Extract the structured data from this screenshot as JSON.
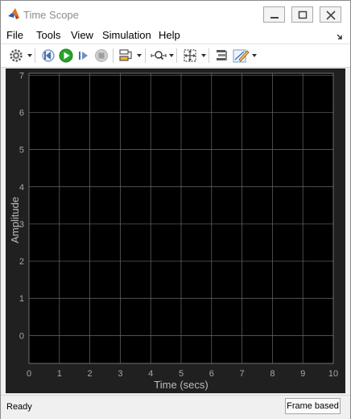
{
  "window": {
    "title": "Time Scope"
  },
  "menu": [
    {
      "label": "File"
    },
    {
      "label": "Tools"
    },
    {
      "label": "View"
    },
    {
      "label": "Simulation"
    },
    {
      "label": "Help"
    }
  ],
  "toolbar": {
    "icons": [
      "settings-icon",
      "step-back-icon",
      "run-icon",
      "step-forward-icon",
      "stop-icon",
      "highlight-icon",
      "zoom-icon",
      "fit-icon",
      "align-icon",
      "style-icon"
    ]
  },
  "colors": {
    "plot_background": "#000000",
    "axes_background": "#202020",
    "grid": "#6b6b6b",
    "tick_text": "#a8a8a8",
    "run_green": "#27a629"
  },
  "chart_data": {
    "type": "line",
    "xlabel": "Time (secs)",
    "ylabel": "Amplitude",
    "xlim": [
      0,
      10
    ],
    "ylim": [
      -0.75,
      7.05
    ],
    "xticks": [
      0,
      1,
      2,
      3,
      4,
      5,
      6,
      7,
      8,
      9,
      10
    ],
    "yticks": [
      0,
      1,
      2,
      3,
      4,
      5,
      6,
      7
    ],
    "grid": true,
    "series": []
  },
  "status": {
    "text": "Ready",
    "mode": "Frame based"
  }
}
